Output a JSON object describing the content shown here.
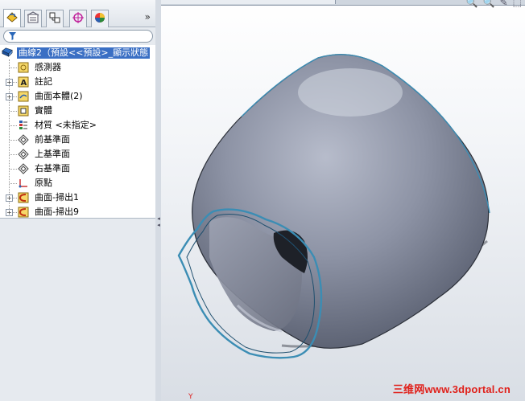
{
  "panel": {
    "tabs": [
      {
        "icon": "feature-manager-icon",
        "glyph": "⚙"
      },
      {
        "icon": "property-manager-icon",
        "glyph": "▤"
      },
      {
        "icon": "configuration-manager-icon",
        "glyph": "⧉"
      },
      {
        "icon": "dimxpert-icon",
        "glyph": "✥"
      },
      {
        "icon": "display-manager-icon",
        "glyph": "◕"
      }
    ],
    "more_glyph": "»"
  },
  "tree": {
    "root_label": "曲線2（預設<<預設>_顯示狀態",
    "items": [
      {
        "label": "感測器",
        "icon": "sensor-icon",
        "expandable": false
      },
      {
        "label": "註記",
        "icon": "annotation-icon",
        "expandable": true
      },
      {
        "label": "曲面本體(2)",
        "icon": "surface-bodies-icon",
        "expandable": true
      },
      {
        "label": "實體",
        "icon": "solid-bodies-icon",
        "expandable": false
      },
      {
        "label": "材質 <未指定>",
        "icon": "material-icon",
        "expandable": false
      },
      {
        "label": "前基準面",
        "icon": "plane-icon",
        "expandable": false
      },
      {
        "label": "上基準面",
        "icon": "plane-icon",
        "expandable": false
      },
      {
        "label": "右基準面",
        "icon": "plane-icon",
        "expandable": false
      },
      {
        "label": "原點",
        "icon": "origin-icon",
        "expandable": false
      },
      {
        "label": "曲面-掃出1",
        "icon": "sweep-surface-icon",
        "expandable": true
      },
      {
        "label": "曲面-掃出9",
        "icon": "sweep-surface-icon",
        "expandable": true
      }
    ]
  },
  "viewport": {
    "watermark": "三维网www.3dportal.cn",
    "triad_label": "Y",
    "tools": [
      "🔍",
      "🔍",
      "✎",
      "⬚"
    ]
  },
  "colors": {
    "body": "#7f8596",
    "edge": "#3b8db4",
    "selection": "#3a6fc4"
  }
}
